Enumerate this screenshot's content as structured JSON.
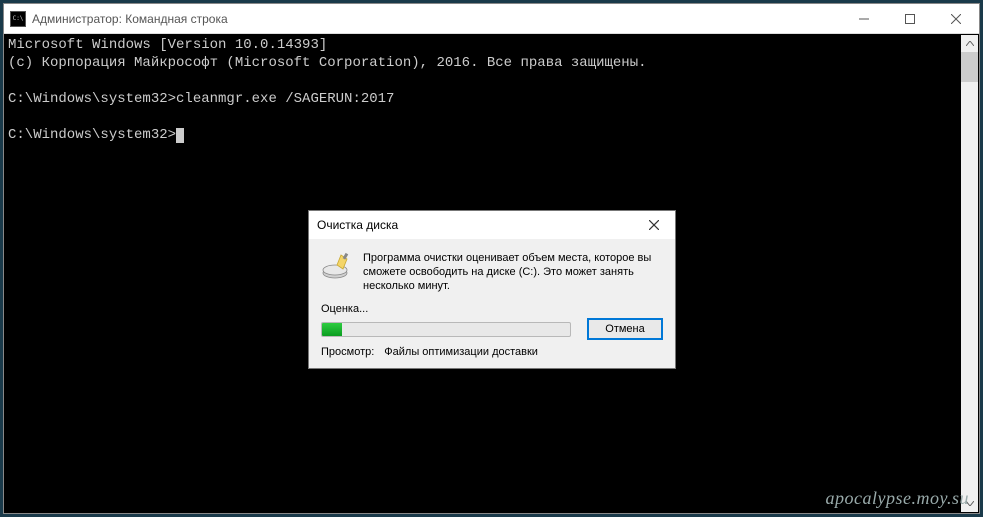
{
  "window": {
    "title": "Администратор: Командная строка"
  },
  "console": {
    "line1": "Microsoft Windows [Version 10.0.14393]",
    "line2": "(c) Корпорация Майкрософт (Microsoft Corporation), 2016. Все права защищены.",
    "blank": "",
    "prompt1": "C:\\Windows\\system32>cleanmgr.exe /SAGERUN:2017",
    "prompt2": "C:\\Windows\\system32>"
  },
  "dialog": {
    "title": "Очистка диска",
    "message": "Программа очистки оценивает объем места, которое вы сможете освободить на диске  (C:). Это может занять несколько минут.",
    "status_label": "Оценка...",
    "cancel_label": "Отмена",
    "view_label": "Просмотр:",
    "view_value": "Файлы оптимизации доставки",
    "progress_percent": 8
  },
  "watermark": "apocalypse.moy.su"
}
